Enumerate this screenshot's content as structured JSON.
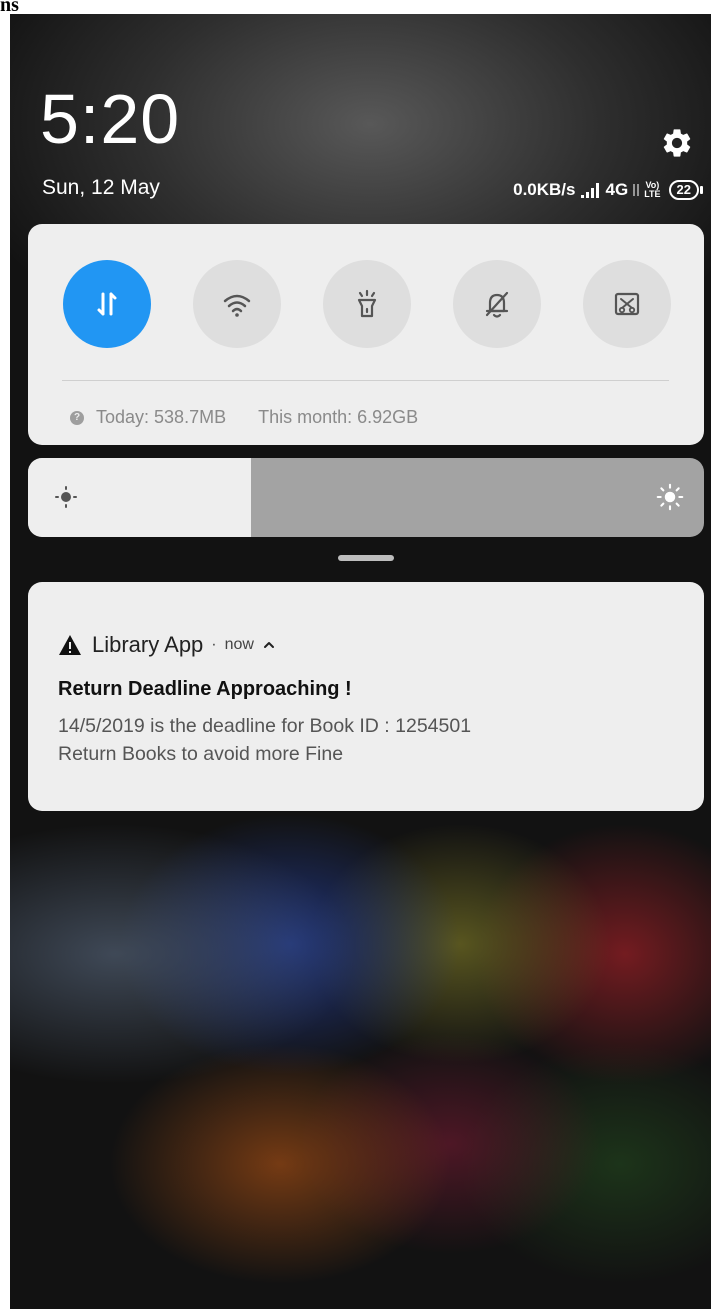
{
  "corner_text": "ns",
  "lock": {
    "time": "5:20",
    "date": "Sun, 12 May"
  },
  "status_bar": {
    "net_speed": "0.0KB/s",
    "network": "4G",
    "volte_top": "Vo)",
    "volte_bottom": "LTE",
    "battery": "22"
  },
  "quick_settings": {
    "tiles": [
      {
        "icon": "mobile-data-icon",
        "active": true
      },
      {
        "icon": "wifi-icon",
        "active": false
      },
      {
        "icon": "flashlight-icon",
        "active": false
      },
      {
        "icon": "silent-mode-icon",
        "active": false
      },
      {
        "icon": "screenshot-icon",
        "active": false
      }
    ],
    "data_today": "Today: 538.7MB",
    "data_month": "This month: 6.92GB"
  },
  "brightness": {
    "level": 0.33
  },
  "notification": {
    "app_name": "Library App",
    "separator": "·",
    "time": "now",
    "title": "Return Deadline Approaching !",
    "body_line1": "14/5/2019 is the deadline for Book ID : 1254501",
    "body_line2": "Return Books to avoid more Fine"
  },
  "colors": {
    "accent": "#2196f3",
    "panel": "#eeeeee",
    "brightness_track": "#a3a3a3"
  }
}
